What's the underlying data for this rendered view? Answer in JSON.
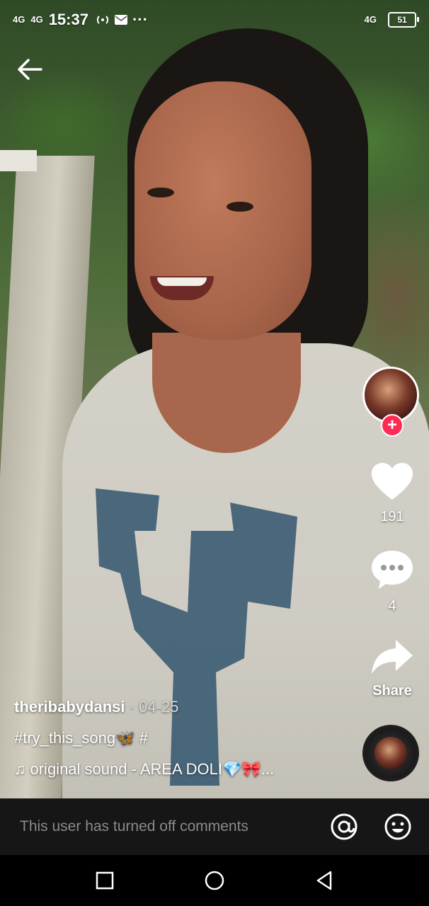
{
  "status_bar": {
    "network_1": "4G",
    "network_2": "4G",
    "time": "15:37",
    "more": "···",
    "network_right": "4G",
    "battery": "51"
  },
  "post": {
    "username": "theribabydansi",
    "date_separator": " · ",
    "date": "04-25",
    "caption": "#try_this_song🦋 #",
    "sound": "original sound - AREA DOLI💎🎀..."
  },
  "actions": {
    "likes": "191",
    "comments": "4",
    "share_label": "Share",
    "follow_symbol": "+"
  },
  "comment_bar": {
    "text": "This user has turned off comments"
  },
  "icons": {
    "back": "back-arrow-icon",
    "like": "heart-icon",
    "comment": "chat-bubble-icon",
    "share": "share-arrow-icon",
    "mention": "at-sign-icon",
    "emoji": "smiley-icon",
    "music": "music-note-icon",
    "nav_recents": "square-icon",
    "nav_home": "circle-icon",
    "nav_back": "triangle-back-icon"
  },
  "colors": {
    "follow_accent": "#fe2c55",
    "comment_bar_bg": "#161616"
  }
}
